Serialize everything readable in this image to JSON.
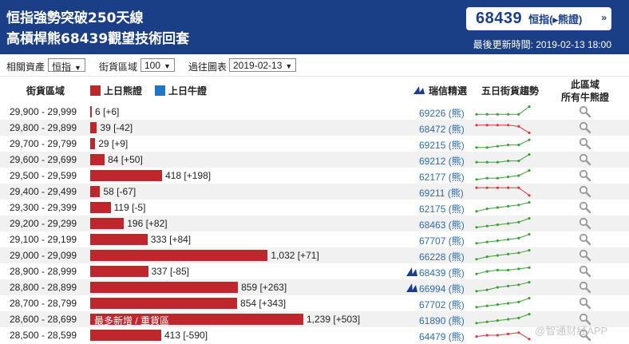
{
  "header": {
    "title_line1": "恒指強勢突破250天線",
    "title_line2": "高槓桿熊68439觀望技術回套",
    "code": "68439",
    "code_label_prefix": "恒指(",
    "code_label_bear": "▸熊證",
    "code_label_suffix": ")",
    "code_arrow": "»",
    "update_time": "最後更新時間: 2019-02-13 18:00"
  },
  "filters": {
    "asset_label": "相關資產",
    "asset_value": "恒指",
    "interval_label": "街貨區域",
    "interval_value": "100",
    "history_label": "過往圖表",
    "history_value": "2019-02-13",
    "caret": "▼"
  },
  "table_header": {
    "range": "街貨區域",
    "bear_legend": "上日熊證",
    "bull_legend": "上日牛證",
    "pick": "瑞信精選",
    "trend": "五日街貨趨勢",
    "all_line1": "此區域",
    "all_line2": "所有牛熊證"
  },
  "colors": {
    "bear": "#c0272d",
    "bull": "#1e78c8",
    "header_bg": "#1b3f86",
    "up": "#3aa335",
    "down": "#e0393e"
  },
  "rows": [
    {
      "range": "29,900 - 29,999",
      "value": 6,
      "label": "6 [+6]",
      "icon": false,
      "price": "69226 (熊)",
      "trend": "up",
      "spark": [
        3,
        3,
        3,
        3,
        3,
        9
      ]
    },
    {
      "range": "29,800 - 29,899",
      "value": 39,
      "label": "39 [-42]",
      "icon": false,
      "price": "68472 (熊)",
      "trend": "down",
      "spark": [
        7,
        7,
        7,
        7,
        6,
        1
      ]
    },
    {
      "range": "29,700 - 29,799",
      "value": 29,
      "label": "29 [+9]",
      "icon": false,
      "price": "69215 (熊)",
      "trend": "up",
      "spark": [
        2,
        2,
        3,
        4,
        4,
        8
      ]
    },
    {
      "range": "29,600 - 29,699",
      "value": 84,
      "label": "84 [+50]",
      "icon": false,
      "price": "69212 (熊)",
      "trend": "up",
      "spark": [
        3,
        3,
        3,
        4,
        4,
        9
      ]
    },
    {
      "range": "29,500 - 29,599",
      "value": 418,
      "label": "418 [+198]",
      "icon": false,
      "price": "62177 (熊)",
      "trend": "up",
      "spark": [
        2,
        3,
        3,
        4,
        5,
        9
      ]
    },
    {
      "range": "29,400 - 29,499",
      "value": 58,
      "label": "58 [-67]",
      "icon": false,
      "price": "69211 (熊)",
      "trend": "down",
      "spark": [
        8,
        8,
        8,
        8,
        8,
        2
      ]
    },
    {
      "range": "29,300 - 29,399",
      "value": 119,
      "label": "119 [-5]",
      "icon": false,
      "price": "62175 (熊)",
      "trend": "up",
      "spark": [
        2,
        4,
        5,
        6,
        7,
        9
      ]
    },
    {
      "range": "29,200 - 29,299",
      "value": 196,
      "label": "196 [+82]",
      "icon": false,
      "price": "68463 (熊)",
      "trend": "up",
      "spark": [
        2,
        3,
        4,
        5,
        6,
        9
      ]
    },
    {
      "range": "29,100 - 29,199",
      "value": 333,
      "label": "333 [+84]",
      "icon": false,
      "price": "67707 (熊)",
      "trend": "up",
      "spark": [
        2,
        3,
        4,
        5,
        6,
        9
      ]
    },
    {
      "range": "29,000 - 29,099",
      "value": 1032,
      "label": "1,032 [+71]",
      "icon": false,
      "price": "66228 (熊)",
      "trend": "up",
      "spark": [
        2,
        4,
        5,
        6,
        7,
        9
      ]
    },
    {
      "range": "28,900 - 28,999",
      "value": 337,
      "label": "337 [-85]",
      "icon": true,
      "price": "68439 (熊)",
      "trend": "up",
      "spark": [
        3,
        5,
        6,
        6,
        7,
        8
      ]
    },
    {
      "range": "28,800 - 28,899",
      "value": 859,
      "label": "859 [+263]",
      "icon": true,
      "price": "66994 (熊)",
      "trend": "up",
      "spark": [
        2,
        3,
        5,
        6,
        7,
        9
      ]
    },
    {
      "range": "28,700 - 28,799",
      "value": 854,
      "label": "854 [+343]",
      "icon": false,
      "price": "67702 (熊)",
      "trend": "up",
      "spark": [
        2,
        3,
        4,
        5,
        6,
        9
      ]
    },
    {
      "range": "28,600 - 28,699",
      "value": 1239,
      "label": "1,239 [+503]",
      "inside": "最多新增 / 重貨區",
      "icon": false,
      "price": "61890 (熊)",
      "trend": "up",
      "spark": [
        2,
        3,
        4,
        5,
        6,
        9
      ]
    },
    {
      "range": "28,500 - 28,599",
      "value": 413,
      "label": "413 [-590]",
      "icon": false,
      "price": "64479 (熊)",
      "trend": "down",
      "spark": [
        4,
        5,
        5,
        6,
        7,
        2
      ]
    }
  ],
  "watermark": "@智通财经APP"
}
